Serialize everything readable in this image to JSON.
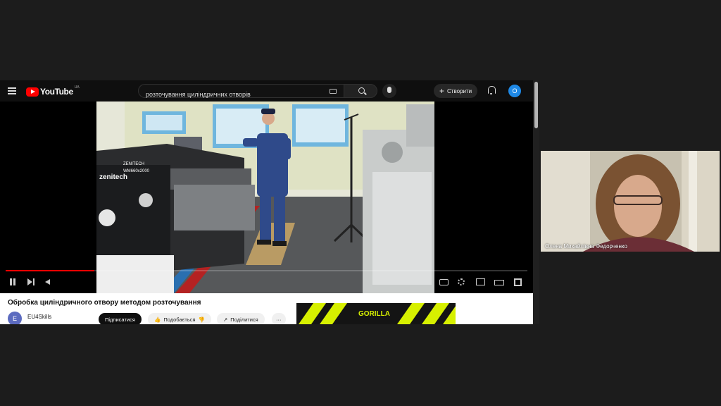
{
  "youtube": {
    "logo_text": "YouTube",
    "logo_country": "UA",
    "search_query": "розточування циліндричних отворів",
    "create_label": "Створити",
    "account_initial": "O"
  },
  "player": {
    "progress": 0.17,
    "overlay_text": {
      "machine_brand": "ZENITECH",
      "machine_model": "WM660x2000",
      "machine_side_brand": "zenitech"
    }
  },
  "video": {
    "title": "Обробка циліндричного отвору методом розточування",
    "channel_initial": "E",
    "channel_name": "EU4Skills",
    "subscribe_label": "Підписатися",
    "like_label": "Подобається",
    "share_label": "Поділитися",
    "more_label": "···"
  },
  "ad": {
    "brand": "GORILLA"
  },
  "participant": {
    "name": "Олена Михайлівна Федорченко"
  },
  "colors": {
    "youtube_red": "#ff0000",
    "ad_accent": "#d7f000",
    "account_blue": "#1e88e5"
  }
}
